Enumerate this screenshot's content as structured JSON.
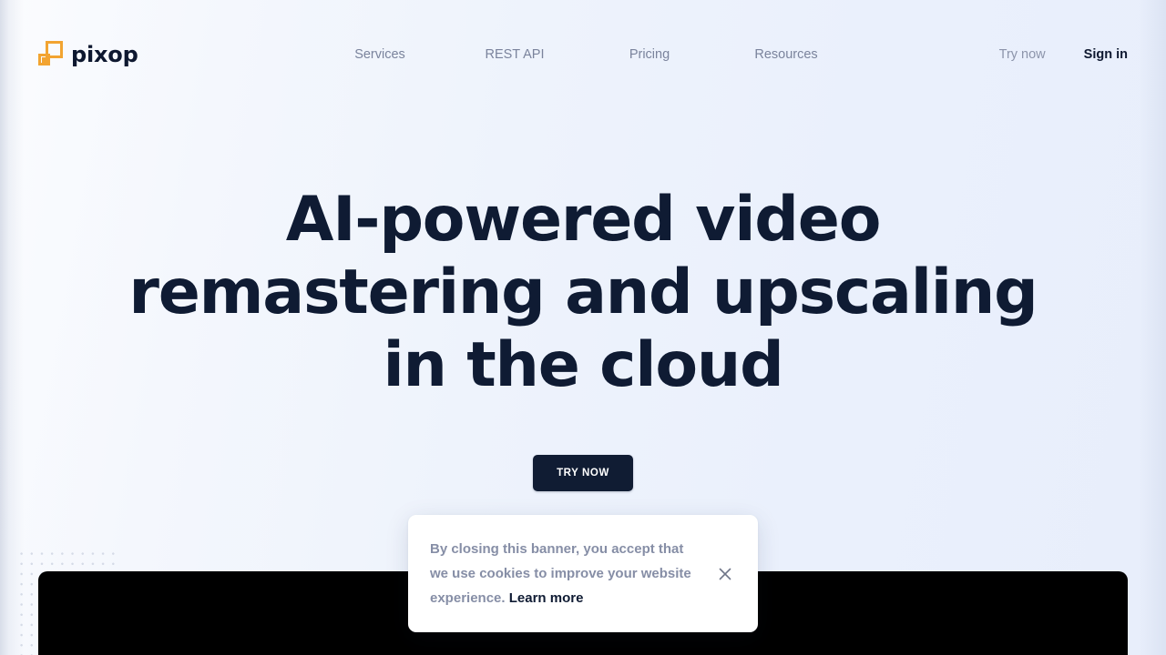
{
  "brand": {
    "logo_word": "pixop",
    "logo_icon": "pixop-squares-logo",
    "accent_color": "#f2a431",
    "dark_color": "#0f1b33"
  },
  "header": {
    "nav_links": [
      {
        "label": "Services",
        "name": "nav-link-services"
      },
      {
        "label": "REST API",
        "name": "nav-link-rest-api"
      },
      {
        "label": "Pricing",
        "name": "nav-link-pricing"
      },
      {
        "label": "Resources",
        "name": "nav-link-resources"
      }
    ],
    "try_now_label": "Try now",
    "sign_in_label": "Sign in"
  },
  "hero": {
    "title": "AI-powered video remastering and upscaling in the cloud",
    "cta_label": "TRY NOW"
  },
  "cookie_banner": {
    "message": "By closing this banner, you accept that we use cookies to improve your website experience. ",
    "learn_more_label": "Learn more",
    "close_icon": "close-icon"
  },
  "video_panel": {
    "background_color": "#000000"
  }
}
